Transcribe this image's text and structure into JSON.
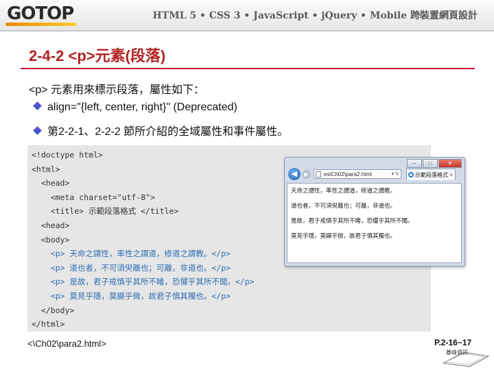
{
  "header": {
    "logo": "GOTOP",
    "tagline": "HTML 5 • CSS 3 • JavaScript • jQuery • Mobile 跨裝置網頁設計"
  },
  "slide": {
    "title": "2-4-2 <p>元素(段落)",
    "intro": "<p> 元素用來標示段落，屬性如下：",
    "bullets": [
      "align=\"{left, center, right}\" (Deprecated)",
      "第2-2-1、2-2-2 節所介紹的全域屬性和事件屬性。"
    ]
  },
  "code": {
    "lines": [
      "<!doctype html>",
      "<html>",
      "  <head>",
      "    <meta charset=\"utf-8\">",
      "    <title> 示範段落格式 </title>",
      "  <head>",
      "  <body>",
      "    <p> 天命之謂性，率性之謂道，修道之謂教。</p>",
      "    <p> 道也者，不可須臾離也；可離，非道也。</p>",
      "    <p> 是故，君子戒慎乎其所不睹，恐懼乎其所不聞。</p>",
      "    <p> 莫見乎隱，莫顯乎微，故君子慎其獨也。</p>",
      "  </body>",
      "</html>"
    ]
  },
  "browser": {
    "address": "es\\Ch02\\para2.html",
    "tab_title": "示範段落格式",
    "paragraphs": [
      "天命之謂性，率性之謂道，修道之謂教。",
      "道也者，不可須臾離也；可離，非道也。",
      "是故，君子戒慎乎其所不睹，恐懼乎其所不聞。",
      "莫見乎隱，莫顯乎微，故君子慎其獨也。"
    ]
  },
  "footer": {
    "file_path": "<\\Ch02\\para2.html>",
    "page_ref": "P.2-16~17",
    "publisher_label": "碁峰資訊"
  },
  "colors": {
    "title": "#b22222",
    "title_rule": "#c8102e",
    "code_panel": "#e6e6e6",
    "code_p_tag": "#2f6fb2"
  }
}
